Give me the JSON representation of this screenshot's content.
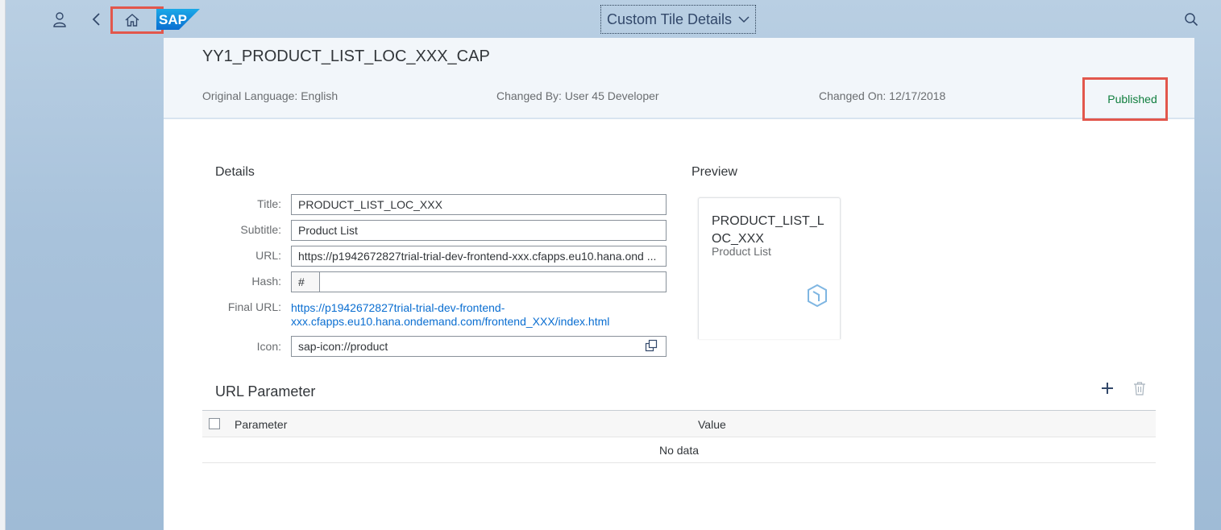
{
  "shell": {
    "title": "Custom Tile Details",
    "logo_text": "SAP"
  },
  "header": {
    "title": "YY1_PRODUCT_LIST_LOC_XXX_CAP",
    "original_language": "Original Language: English",
    "changed_by": "Changed By: User 45 Developer",
    "changed_on": "Changed On: 12/17/2018",
    "status": "Published"
  },
  "details": {
    "section_title": "Details",
    "labels": {
      "title": "Title:",
      "subtitle": "Subtitle:",
      "url": "URL:",
      "hash": "Hash:",
      "final_url": "Final URL:",
      "icon": "Icon:"
    },
    "title_value": "PRODUCT_LIST_LOC_XXX",
    "subtitle_value": "Product List",
    "url_value": "https://p1942672827trial-trial-dev-frontend-xxx.cfapps.eu10.hana.ond ...",
    "hash_prefix": "#",
    "hash_value": "",
    "final_url_line1": "https://p1942672827trial-trial-dev-frontend-",
    "final_url_line2": "xxx.cfapps.eu10.hana.ondemand.com/frontend_XXX/index.html",
    "icon_value": "sap-icon://product"
  },
  "preview": {
    "section_title": "Preview",
    "tile_title": "PRODUCT_LIST_LOC_XXX",
    "tile_subtitle": "Product List"
  },
  "url_parameter": {
    "section_title": "URL Parameter",
    "columns": [
      "Parameter",
      "Value"
    ],
    "empty_text": "No data"
  },
  "colors": {
    "status_positive": "#107e3e",
    "link": "#0a6ed1",
    "highlight": "#e2574c"
  },
  "icons": [
    "user-icon",
    "back-icon",
    "home-icon",
    "search-icon",
    "value-help-icon",
    "product-icon",
    "add-icon",
    "delete-icon"
  ]
}
